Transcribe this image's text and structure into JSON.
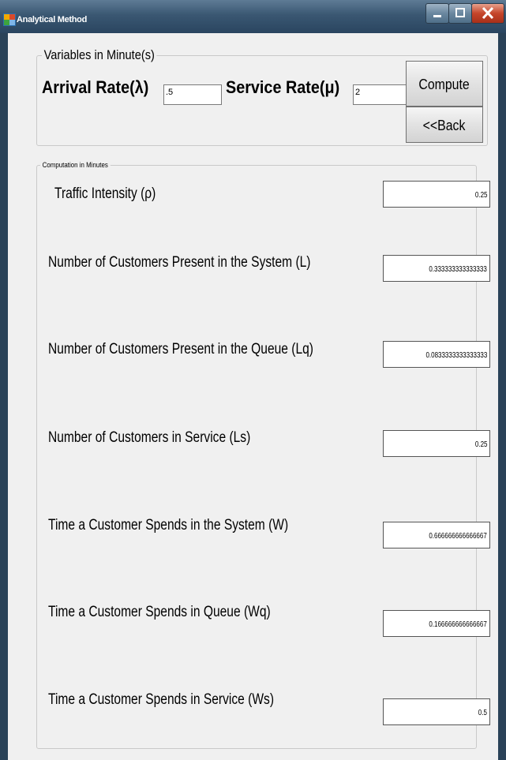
{
  "window": {
    "title": "Analytical Method",
    "controls": {
      "minimize": "-",
      "maximize": "□",
      "close": "X"
    }
  },
  "variables": {
    "group_label": "Variables in Minute(s)",
    "arrival_label": "Arrival Rate(λ)",
    "arrival_value": ".5",
    "service_label": "Service Rate(μ)",
    "service_value": "2",
    "compute_label": "Compute",
    "back_label": "<<Back"
  },
  "computation": {
    "group_label": "Computation in Minutes",
    "rows": [
      {
        "label": "Traffic Intensity (ρ)",
        "value": "0.25"
      },
      {
        "label": "Number of Customers Present in the System (L)",
        "value": "0.333333333333333"
      },
      {
        "label": "Number of Customers Present in the Queue (Lq)",
        "value": "0.0833333333333333"
      },
      {
        "label": "Number of Customers in Service (Ls)",
        "value": "0.25"
      },
      {
        "label": "Time a Customer Spends in the System (W)",
        "value": "0.666666666666667"
      },
      {
        "label": "Time a Customer Spends in Queue (Wq)",
        "value": "0.166666666666667"
      },
      {
        "label": "Time a Customer Spends in Service (Ws)",
        "value": "0.5"
      }
    ]
  },
  "colors": {
    "titlebar": "#3a5772",
    "client_background": "#f0f0f0",
    "close_button": "#c5452a"
  }
}
